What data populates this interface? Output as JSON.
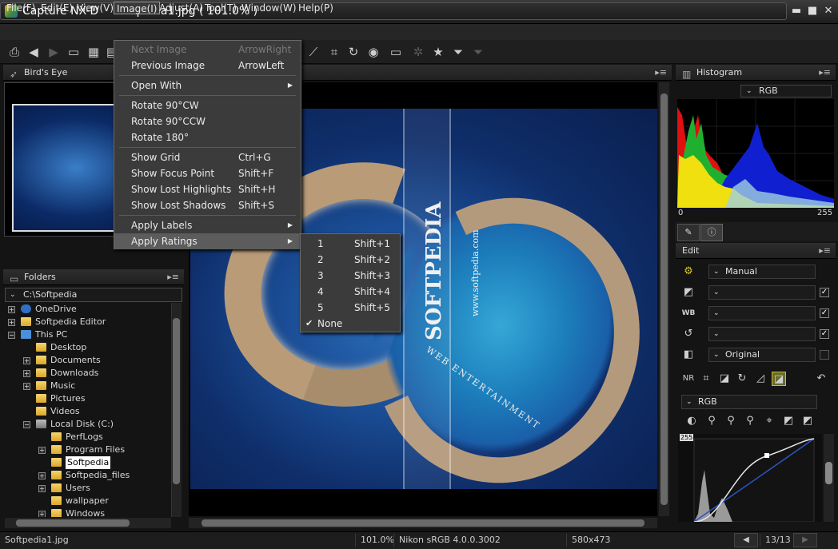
{
  "window": {
    "app_title": "Capture NX-D",
    "file_title": "Softpedia1.jpg ( 101.0% )",
    "minimize_glyph": "▬",
    "maximize_glyph": "■",
    "close_glyph": "✕"
  },
  "menubar": {
    "items": [
      "File(F)",
      "Edit(E)",
      "View(V)",
      "Image(I)",
      "Adjust(A)",
      "Tool(T)",
      "Window(W)",
      "Help(P)"
    ],
    "active": "Image(I)"
  },
  "toolbar": {
    "icons": [
      "print-icon",
      "back-arrow-icon",
      "forward-arrow-icon",
      "folder-icon",
      "grid-icon",
      "filmstrip-icon",
      "crop-straighten-icon",
      "crop-icon",
      "rotate-icon",
      "app-icon",
      "display-icon",
      "batch-icon",
      "star-icon",
      "filter-icon",
      "filter-clear-icon"
    ]
  },
  "birdseye": {
    "title": "Bird's Eye"
  },
  "folders": {
    "title": "Folders",
    "path": "C:\\Softpedia",
    "tree": [
      {
        "label": "OneDrive",
        "indent": 0
      },
      {
        "label": "Softpedia Editor",
        "indent": 0
      },
      {
        "label": "This PC",
        "indent": 0
      },
      {
        "label": "Desktop",
        "indent": 1
      },
      {
        "label": "Documents",
        "indent": 1
      },
      {
        "label": "Downloads",
        "indent": 1
      },
      {
        "label": "Music",
        "indent": 1
      },
      {
        "label": "Pictures",
        "indent": 1
      },
      {
        "label": "Videos",
        "indent": 1
      },
      {
        "label": "Local Disk (C:)",
        "indent": 1
      },
      {
        "label": "PerfLogs",
        "indent": 2
      },
      {
        "label": "Program Files",
        "indent": 2
      },
      {
        "label": "Softpedia",
        "indent": 2,
        "selected": true
      },
      {
        "label": "Softpedia_files",
        "indent": 2
      },
      {
        "label": "Users",
        "indent": 2
      },
      {
        "label": "wallpaper",
        "indent": 2
      },
      {
        "label": "Windows",
        "indent": 2
      }
    ]
  },
  "image": {
    "watermark_big": "SOFTPEDIA",
    "watermark_url": "www.softpedia.com",
    "watermark_ent": "WEB ENTERTAINMENT"
  },
  "image_menu": {
    "items": [
      {
        "label": "Next Image",
        "shortcut": "ArrowRight",
        "disabled": true
      },
      {
        "label": "Previous Image",
        "shortcut": "ArrowLeft"
      },
      {
        "label": "Open With",
        "submenu": true
      },
      {
        "label": "Rotate 90°CW"
      },
      {
        "label": "Rotate 90°CCW"
      },
      {
        "label": "Rotate 180°"
      },
      {
        "label": "Show Grid",
        "shortcut": "Ctrl+G"
      },
      {
        "label": "Show Focus Point",
        "shortcut": "Shift+F"
      },
      {
        "label": "Show Lost Highlights",
        "shortcut": "Shift+H"
      },
      {
        "label": "Show Lost Shadows",
        "shortcut": "Shift+S"
      },
      {
        "label": "Apply Labels",
        "submenu": true
      },
      {
        "label": "Apply Ratings",
        "submenu": true,
        "highlighted": true
      }
    ]
  },
  "ratings_menu": {
    "items": [
      {
        "label": "1",
        "shortcut": "Shift+1"
      },
      {
        "label": "2",
        "shortcut": "Shift+2"
      },
      {
        "label": "3",
        "shortcut": "Shift+3"
      },
      {
        "label": "4",
        "shortcut": "Shift+4"
      },
      {
        "label": "5",
        "shortcut": "Shift+5"
      },
      {
        "label": "None",
        "checked": true
      }
    ]
  },
  "histogram": {
    "title": "Histogram",
    "channel": "RGB",
    "min_label": "0",
    "max_label": "255"
  },
  "edit": {
    "title": "Edit",
    "picture_control": "Manual",
    "color_mode": "Original",
    "curve_channel": "RGB",
    "curve_max_label": "255"
  },
  "statusbar": {
    "filename": "Softpedia1.jpg",
    "zoom": "101.0%",
    "profile": "Nikon sRGB 4.0.0.3002",
    "dimensions": "580x473",
    "position": "13/13"
  }
}
